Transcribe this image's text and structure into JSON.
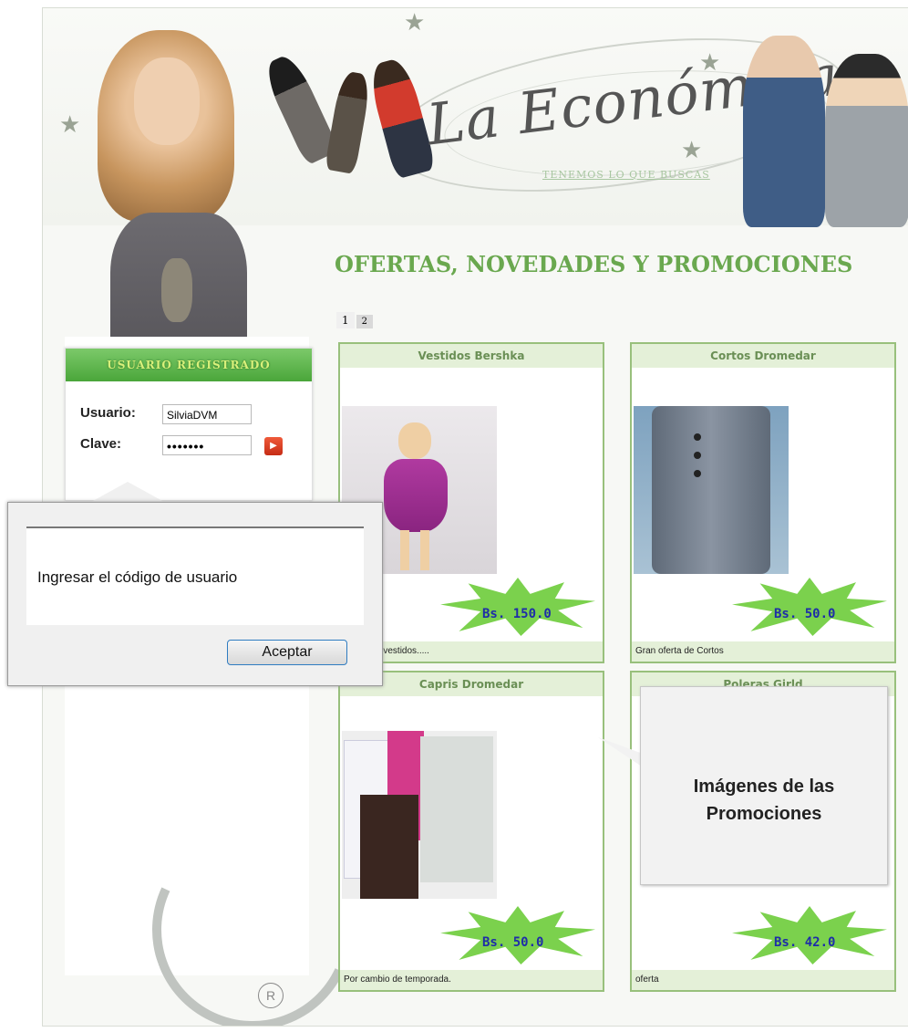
{
  "header": {
    "logo_text": "La Económica",
    "tagline": "TENEMOS LO QUE BUSCAS"
  },
  "promo": {
    "title": "OFERTAS, NOVEDADES Y PROMOCIONES",
    "pages": [
      "1",
      "2"
    ]
  },
  "login": {
    "title": "USUARIO REGISTRADO",
    "user_label": "Usuario:",
    "user_value": "SilviaDVM",
    "pass_label": "Clave:",
    "pass_value": "•••••••"
  },
  "dialog": {
    "message": "Ingresar el código de usuario",
    "button": "Aceptar"
  },
  "cards": [
    {
      "title": "Vestidos Bershka",
      "price": "Bs. 150.0",
      "description": "n nuevos vestidos....."
    },
    {
      "title": "Cortos Dromedar",
      "price": "Bs. 50.0",
      "description": "Gran oferta de Cortos"
    },
    {
      "title": "Capris Dromedar",
      "price": "Bs. 50.0",
      "description": "Por cambio de temporada."
    },
    {
      "title": "Poleras Girld",
      "price": "Bs. 42.0",
      "description": "oferta"
    }
  ],
  "annotation": {
    "line1": "Imágenes de las",
    "line2": "Promociones"
  },
  "footer": {
    "registered_mark": "R"
  },
  "colors": {
    "accent_green": "#6aa84f",
    "card_border": "#98c07c",
    "price_blue": "#1e2da8"
  }
}
